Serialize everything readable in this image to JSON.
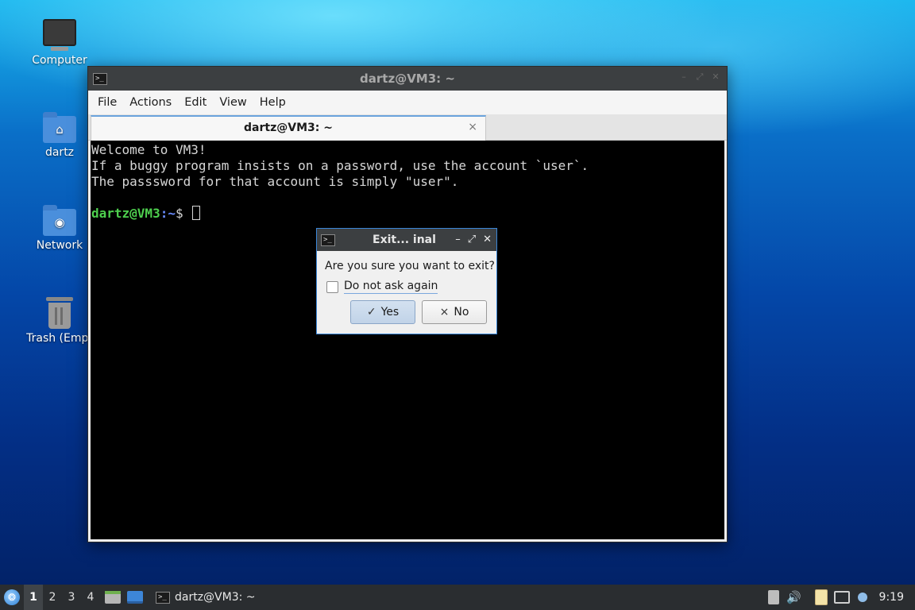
{
  "desktop": {
    "icons": [
      {
        "label": "Computer",
        "icon": "computer-icon"
      },
      {
        "label": "dartz",
        "icon": "home-folder-icon"
      },
      {
        "label": "Network",
        "icon": "network-folder-icon"
      },
      {
        "label": "Trash (Empt",
        "icon": "trash-icon"
      }
    ]
  },
  "terminal": {
    "window_title": "dartz@VM3: ~",
    "menu": [
      "File",
      "Actions",
      "Edit",
      "View",
      "Help"
    ],
    "tab_label": "dartz@VM3: ~",
    "tab_close": "×",
    "lines": [
      "Welcome to VM3!",
      "If a buggy program insists on a password, use the account `user`.",
      "The passsword for that account is simply \"user\"."
    ],
    "prompt": {
      "user_host": "dartz@VM3",
      "sep": ":",
      "path": "~",
      "symbol": "$ "
    }
  },
  "dialog": {
    "title": "Exit... inal",
    "message": "Are you sure you want to exit?",
    "checkbox_label": "Do not ask again",
    "checkbox_checked": false,
    "yes_label": "Yes",
    "yes_glyph": "✓",
    "no_label": "No",
    "no_glyph": "×"
  },
  "taskbar": {
    "workspaces": [
      "1",
      "2",
      "3",
      "4"
    ],
    "active_workspace": "1",
    "task_label": "dartz@VM3: ~",
    "clock": "9:19"
  },
  "colors": {
    "titlebar": "#3c3f41",
    "terminal_bg": "#000000",
    "prompt_user": "#4ecf4e",
    "prompt_path": "#6a8dff",
    "dialog_border": "#3a86d8",
    "taskbar": "#2a2d30"
  }
}
